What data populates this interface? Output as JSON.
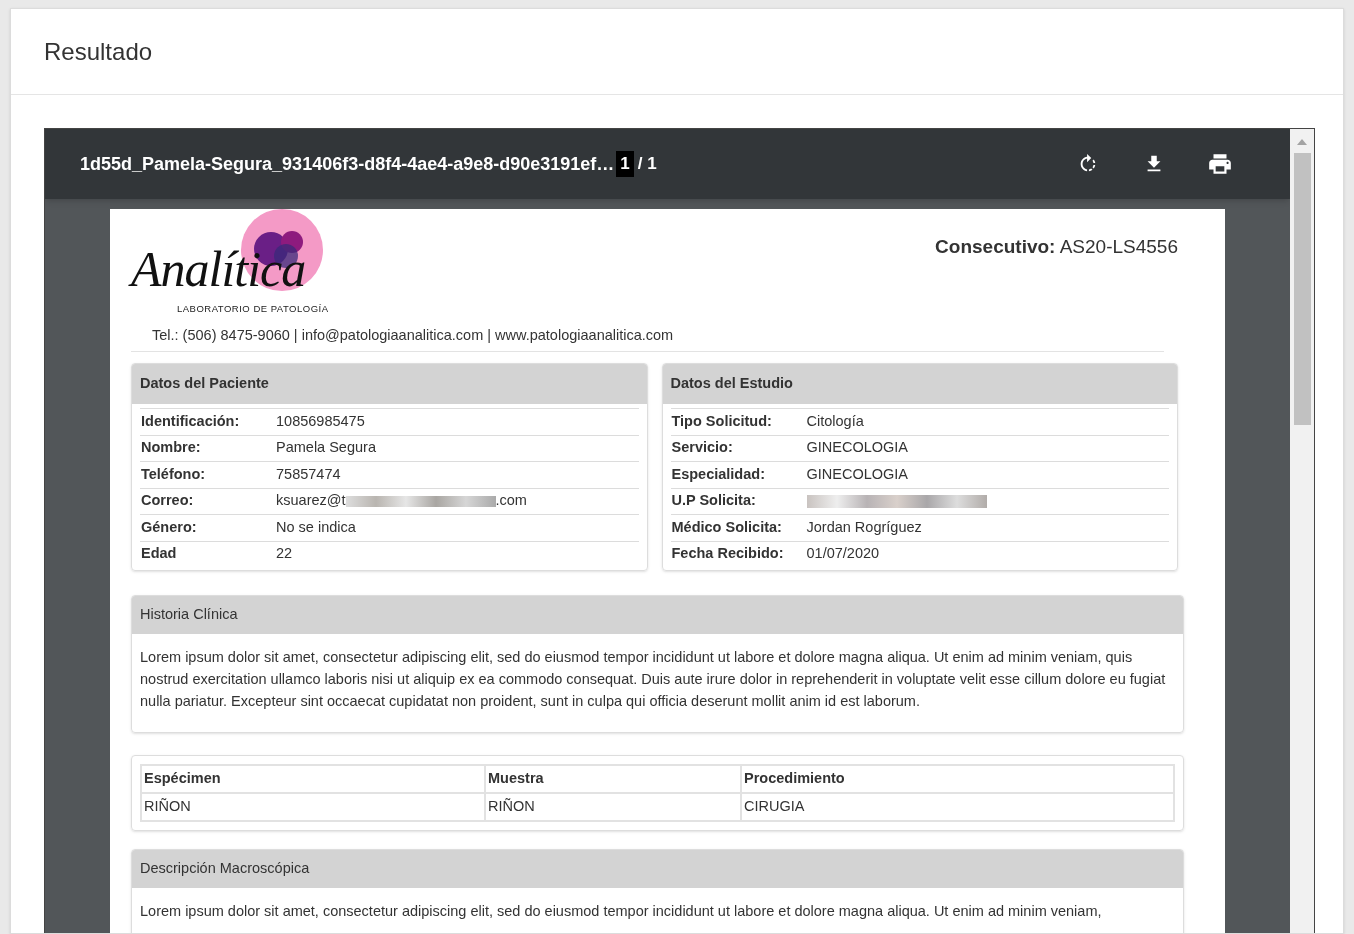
{
  "card": {
    "title": "Resultado"
  },
  "viewer": {
    "file_name": "1d55d_Pamela-Segura_931406f3-d8f4-4ae4-a9e8-d90e3191ef…",
    "page_current": "1",
    "page_total": "/ 1"
  },
  "document": {
    "header": {
      "logo_name": "Analítica",
      "logo_subtitle": "LABORATORIO DE PATOLOGÍA",
      "contact": "Tel.: (506) 8475-9060 | info@patologiaanalitica.com | www.patologiaanalitica.com",
      "consecutivo_label": "Consecutivo:",
      "consecutivo_value": "AS20-LS4556"
    },
    "panels": [
      {
        "title": "Datos del Paciente",
        "rows": [
          {
            "kind": "text",
            "label": "Identificación:",
            "value": "10856985475"
          },
          {
            "kind": "text",
            "label": "Nombre:",
            "value": "Pamela Segura"
          },
          {
            "kind": "text",
            "label": "Teléfono:",
            "value": "75857474"
          },
          {
            "kind": "partly_redacted",
            "label": "Correo:",
            "value": "ksuarez@t",
            "value_end": ".com"
          },
          {
            "kind": "text",
            "label": "Género:",
            "value": "No se indica"
          },
          {
            "kind": "text",
            "label": "Edad",
            "value": "22"
          }
        ]
      },
      {
        "title": "Datos del Estudio",
        "rows": [
          {
            "kind": "text",
            "label": "Tipo Solicitud:",
            "value": "Citología"
          },
          {
            "kind": "text",
            "label": "Servicio:",
            "value": "GINECOLOGIA"
          },
          {
            "kind": "text",
            "label": "Especialidad:",
            "value": "GINECOLOGIA"
          },
          {
            "kind": "redacted",
            "label": "U.P Solicita:"
          },
          {
            "kind": "text",
            "label": "Médico Solicita:",
            "value": "Jordan Rogríguez"
          },
          {
            "kind": "text",
            "label": "Fecha Recibido:",
            "value": "01/07/2020"
          }
        ]
      }
    ],
    "historia": {
      "title": "Historia Clínica",
      "text": "Lorem ipsum dolor sit amet, consectetur adipiscing elit, sed do eiusmod tempor incididunt ut labore et dolore magna aliqua. Ut enim ad minim veniam, quis nostrud exercitation ullamco laboris nisi ut aliquip ex ea commodo consequat. Duis aute irure dolor in reprehenderit in voluptate velit esse cillum dolore eu fugiat nulla pariatur. Excepteur sint occaecat cupidatat non proident, sunt in culpa qui officia deserunt mollit anim id est laborum."
    },
    "specimen_table": {
      "columns": [
        "Espécimen",
        "Muestra",
        "Procedimiento"
      ],
      "rows": [
        [
          "RIÑON",
          "RIÑON",
          "CIRUGIA"
        ]
      ]
    },
    "macroscopica": {
      "title": "Descripción Macroscópica",
      "text": "Lorem ipsum dolor sit amet, consectetur adipiscing elit, sed do eiusmod tempor incididunt ut labore et dolore magna aliqua. Ut enim ad minim veniam,"
    }
  }
}
